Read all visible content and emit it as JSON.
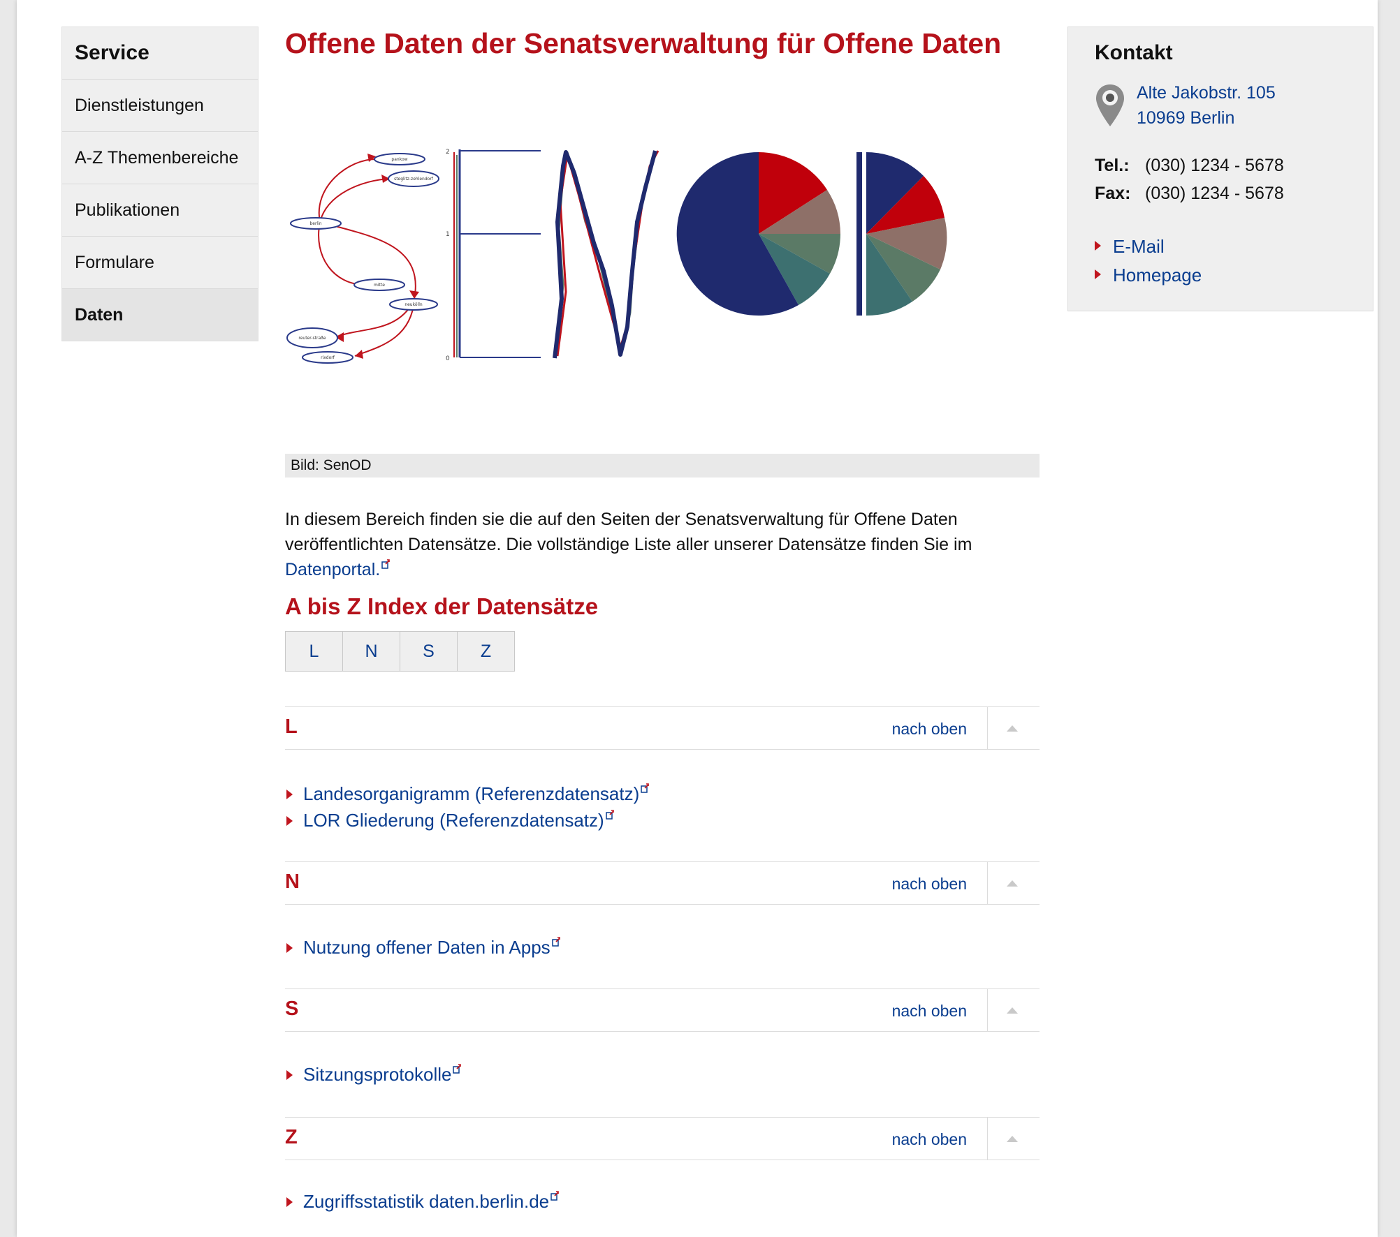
{
  "sidebar": {
    "heading": "Service",
    "items": [
      {
        "label": "Dienstleistungen"
      },
      {
        "label": "A-Z Themenbereiche"
      },
      {
        "label": "Publikationen"
      },
      {
        "label": "Formulare"
      },
      {
        "label": "Daten"
      }
    ],
    "active": "Daten"
  },
  "main": {
    "title": "Offene Daten der Senatsverwaltung für Offene Daten",
    "figure_caption": "Bild: SenOD",
    "figure_labels": [
      "pankow",
      "steglitz-zehlendorf",
      "berlin",
      "mitte",
      "neukölln",
      "reuter-straße",
      "rixdorf"
    ],
    "figure_ticks": [
      "2",
      "1",
      "0"
    ],
    "intro_text": "In diesem Bereich finden sie die auf den Seiten der Senatsverwaltung für Offene Daten veröffentlichten Datensätze. Die vollständige Liste aller unserer Datensätze finden Sie im ",
    "intro_link": "Datenportal.",
    "az_heading": "A bis Z Index der Datensätze",
    "letters": [
      "L",
      "N",
      "S",
      "Z"
    ],
    "back_to_top": "nach oben",
    "sections": [
      {
        "letter": "L",
        "items": [
          "Landesorganigramm (Referenzdatensatz)",
          "LOR Gliederung (Referenzdatensatz)"
        ]
      },
      {
        "letter": "N",
        "items": [
          "Nutzung offener Daten in Apps"
        ]
      },
      {
        "letter": "S",
        "items": [
          "Sitzungsprotokolle"
        ]
      },
      {
        "letter": "Z",
        "items": [
          "Zugriffsstatistik daten.berlin.de"
        ]
      }
    ]
  },
  "contact": {
    "heading": "Kontakt",
    "street": "Alte Jakobstr. 105",
    "city": "10969 Berlin",
    "tel_label": "Tel.:",
    "tel": "(030) 1234 - 5678",
    "fax_label": "Fax:",
    "fax": "(030) 1234 - 5678",
    "links": [
      "E-Mail",
      "Homepage"
    ]
  },
  "colors": {
    "accent_red": "#b5121b",
    "link_blue": "#0a3d8f",
    "navy": "#1f2a6e",
    "brown": "#8e7068",
    "green": "#5b7a66",
    "teal": "#3d7070"
  }
}
